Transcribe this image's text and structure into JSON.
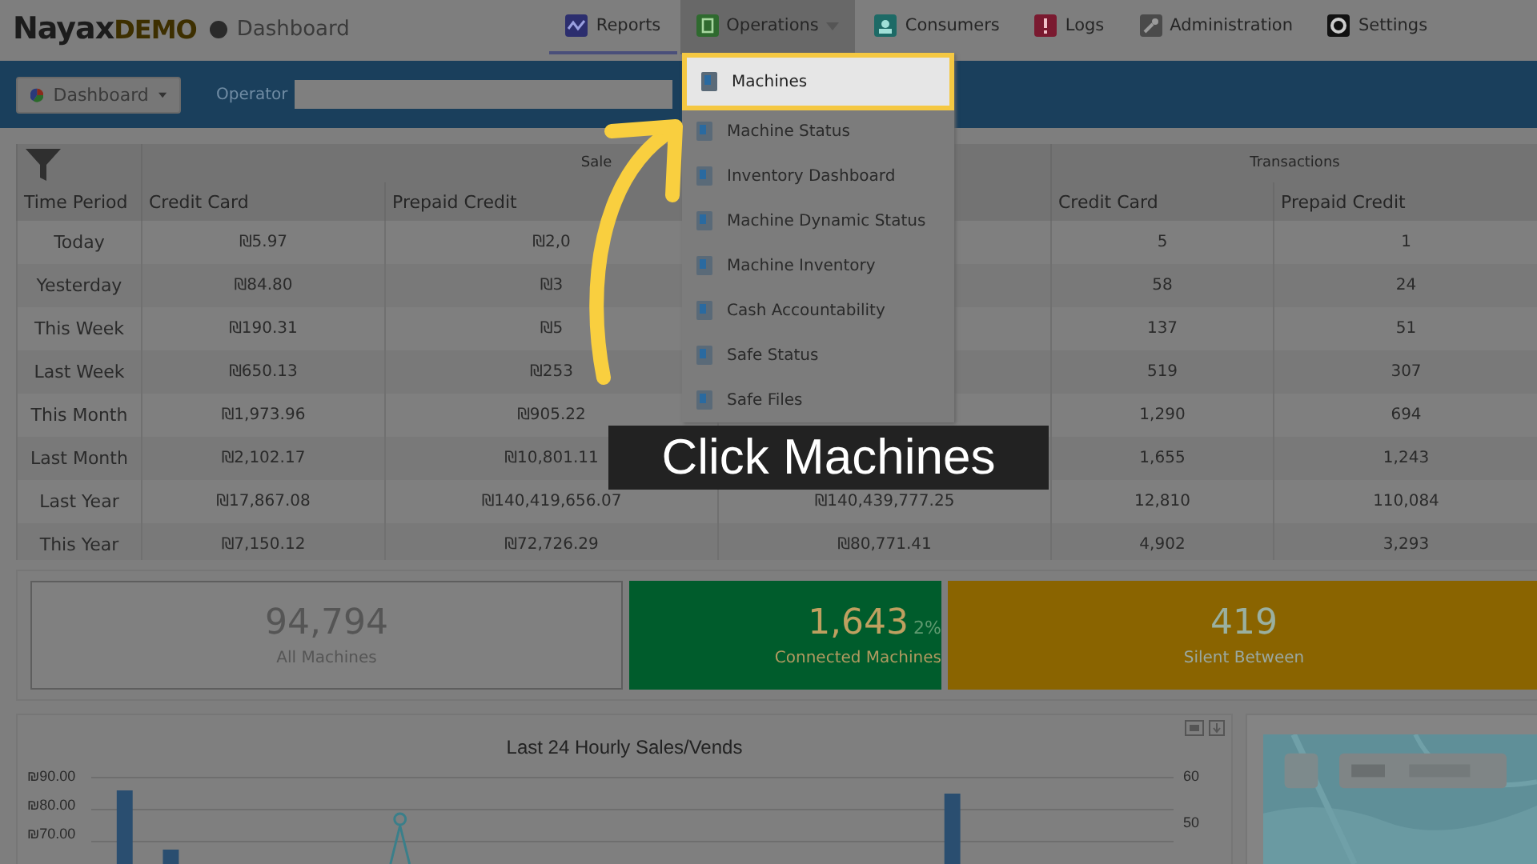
{
  "header": {
    "logo": "Nayax",
    "logo_suffix": "DEMO",
    "page": "Dashboard",
    "nav": [
      {
        "label": "Reports",
        "kind": "link",
        "selected": true
      },
      {
        "label": "Operations",
        "kind": "dropdown",
        "selected": false,
        "expanded": true
      },
      {
        "label": "Consumers",
        "kind": "link",
        "selected": false
      },
      {
        "label": "Logs",
        "kind": "link",
        "selected": false
      },
      {
        "label": "Administration",
        "kind": "link",
        "selected": false
      },
      {
        "label": "Settings",
        "kind": "link",
        "selected": false
      }
    ]
  },
  "toolbar": {
    "view": "Dashboard",
    "operator_label": "Operator"
  },
  "operations_menu": {
    "items": [
      {
        "label": "Machines",
        "selected": true
      },
      {
        "label": "Machine Status",
        "selected": false
      },
      {
        "label": "Inventory Dashboard",
        "selected": false
      },
      {
        "label": "Machine Dynamic Status",
        "selected": false
      },
      {
        "label": "Machine Inventory",
        "selected": false
      },
      {
        "label": "Cash Accountability",
        "selected": false
      },
      {
        "label": "Safe Status",
        "selected": false
      },
      {
        "label": "Safe Files",
        "selected": false
      }
    ]
  },
  "sales_table": {
    "groups": [
      "Sale",
      "Transactions"
    ],
    "columns": [
      "Time Period",
      "Credit Card",
      "Prepaid Credit",
      "Credit Card",
      "Prepaid Credit"
    ],
    "rows": [
      {
        "period": "Today",
        "sales_credit_card": "₪5.97",
        "sales_prepaid_credit": "₪2,0",
        "tx_credit_card": "5",
        "tx_prepaid_credit": "1"
      },
      {
        "period": "Yesterday",
        "sales_credit_card": "₪84.80",
        "sales_prepaid_credit": "₪3",
        "tx_credit_card": "58",
        "tx_prepaid_credit": "24"
      },
      {
        "period": "This Week",
        "sales_credit_card": "₪190.31",
        "sales_prepaid_credit": "₪5",
        "tx_credit_card": "137",
        "tx_prepaid_credit": "51"
      },
      {
        "period": "Last Week",
        "sales_credit_card": "₪650.13",
        "sales_prepaid_credit": "₪253",
        "tx_credit_card": "519",
        "tx_prepaid_credit": "307"
      },
      {
        "period": "This Month",
        "sales_credit_card": "₪1,973.96",
        "sales_prepaid_credit": "₪905.22",
        "tx_credit_card": "1,290",
        "tx_prepaid_credit": "694"
      },
      {
        "period": "Last Month",
        "sales_credit_card": "₪2,102.17",
        "sales_prepaid_credit": "₪10,801.11",
        "tx_credit_card": "1,655",
        "tx_prepaid_credit": "1,243"
      },
      {
        "period": "Last Year",
        "sales_credit_card": "₪17,867.08",
        "sales_prepaid_credit": "₪140,419,656.07",
        "column_4": "₪140,439,777.25",
        "tx_credit_card": "12,810",
        "tx_prepaid_credit": "110,084"
      },
      {
        "period": "This Year",
        "sales_credit_card": "₪7,150.12",
        "sales_prepaid_credit": "₪72,726.29",
        "column_4": "₪80,771.41",
        "tx_credit_card": "4,902",
        "tx_prepaid_credit": "3,293"
      }
    ]
  },
  "stat_cards": [
    {
      "value": "94,794",
      "label": "All Machines"
    },
    {
      "value": "1,643",
      "percent": "2%",
      "label": "Connected Machines",
      "color": "#005c2c"
    },
    {
      "value": "419",
      "label": "Silent Between",
      "color": "#8a6400"
    }
  ],
  "chart": {
    "title": "Last 24 Hourly Sales/Vends",
    "left_ticks": [
      "₪90.00",
      "₪80.00",
      "₪70.00"
    ],
    "right_ticks": [
      "60",
      "50"
    ]
  },
  "callout": {
    "text": "Click Machines"
  }
}
